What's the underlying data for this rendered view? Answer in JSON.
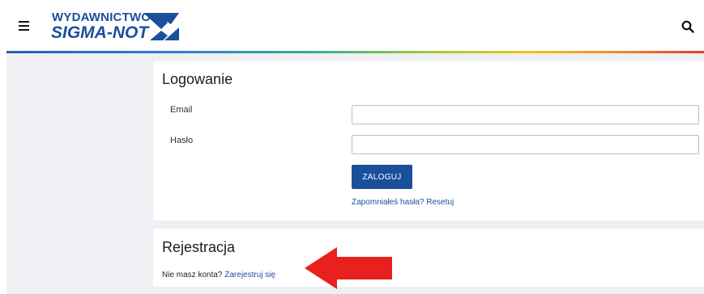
{
  "header": {
    "logo_line1": "WYDAWNICTWO",
    "logo_line2": "SIGMA-NOT",
    "menu_icon": "hamburger-icon",
    "search_icon": "search-icon"
  },
  "login": {
    "title": "Logowanie",
    "email_label": "Email",
    "email_value": "",
    "password_label": "Hasło",
    "password_value": "",
    "submit_label": "ZALOGUJ",
    "forgot_label": "Zapomniałeś hasła? Resetuj"
  },
  "register": {
    "title": "Rejestracja",
    "prompt": "Nie masz konta?",
    "link_label": "Zarejestruj się"
  },
  "colors": {
    "brand": "#1a4f9c",
    "background": "#eef0f3",
    "arrow": "#e8201e"
  }
}
